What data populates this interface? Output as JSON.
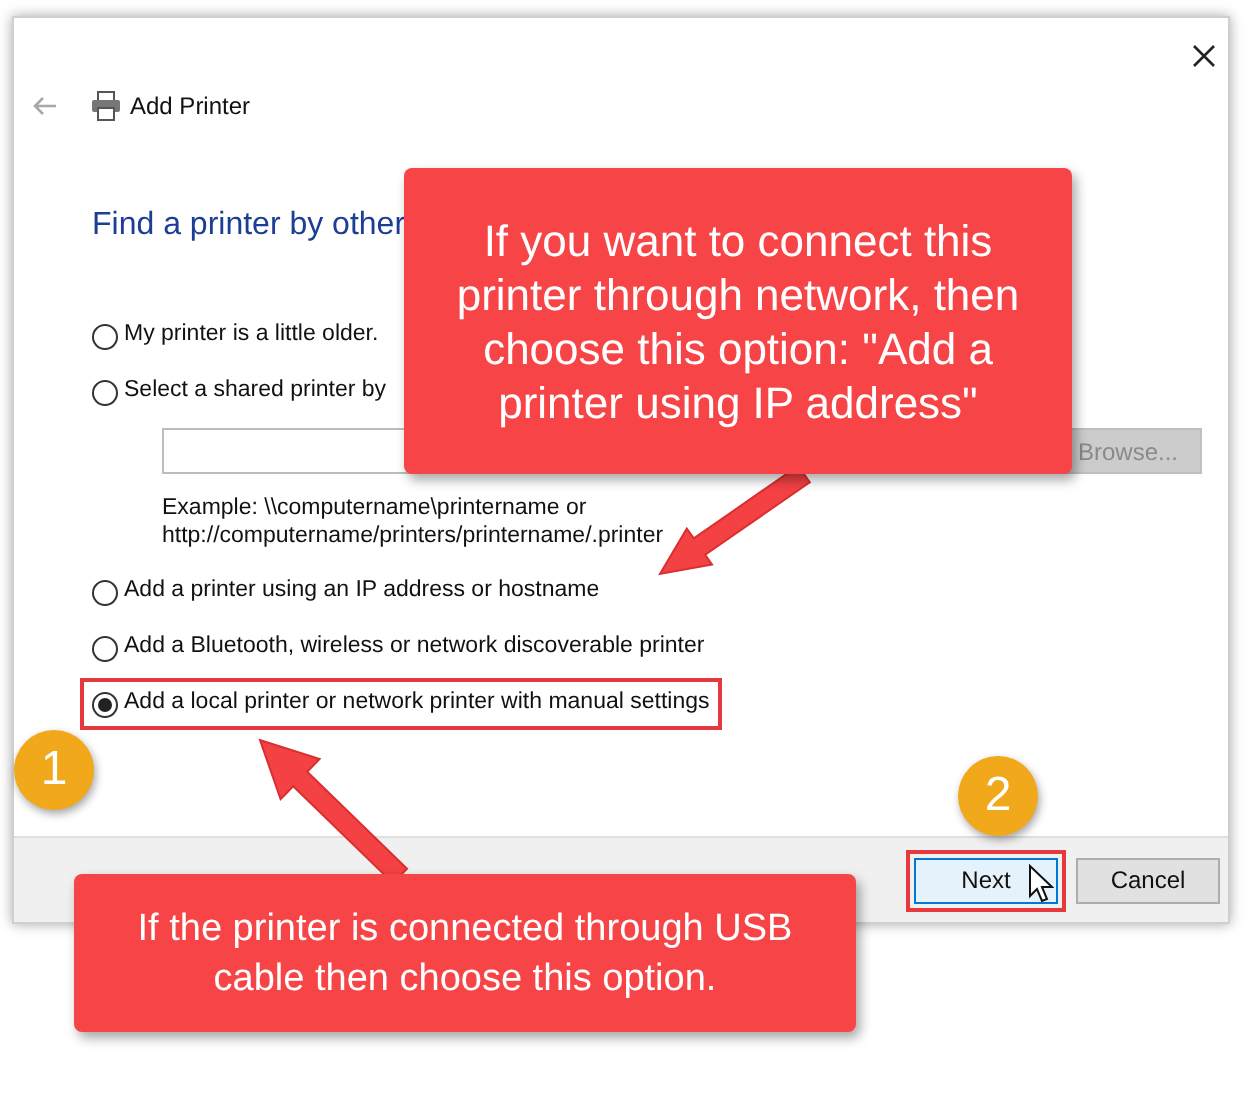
{
  "window": {
    "title": "Add Printer"
  },
  "heading": "Find a printer by other",
  "options": [
    {
      "label": "My printer is a little older.",
      "selected": false,
      "highlighted": false
    },
    {
      "label": "Select a shared printer by",
      "selected": false,
      "highlighted": false
    },
    {
      "label": "Add a printer using an IP address or hostname",
      "selected": false,
      "highlighted": false
    },
    {
      "label": "Add a Bluetooth, wireless or network discoverable printer",
      "selected": false,
      "highlighted": false
    },
    {
      "label": "Add a local printer or network printer with manual settings",
      "selected": true,
      "highlighted": true
    }
  ],
  "browse_button": {
    "label": "Browse...",
    "disabled": true
  },
  "example": [
    "Example: \\\\computername\\printername or",
    "http://computername/printers/printername/.printer"
  ],
  "buttons": [
    {
      "label": "Next",
      "default": true,
      "highlighted": true
    },
    {
      "label": "Cancel",
      "default": false,
      "highlighted": false
    }
  ],
  "callouts": [
    "If you want to connect this printer through network, then choose this option: \"Add a printer using IP address\"",
    "If the printer is connected through USB cable then choose this option."
  ],
  "badges": [
    "1",
    "2"
  ]
}
